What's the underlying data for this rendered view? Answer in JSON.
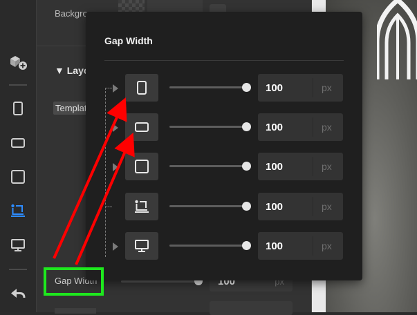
{
  "panel": {
    "background_label": "Backgro",
    "layout_heading": "Layo",
    "template_chip": "Templat",
    "gap_width_row": {
      "label": "Gap Width",
      "value": "100",
      "unit": "px"
    }
  },
  "popup": {
    "title": "Gap Width",
    "devices": [
      {
        "icon": "phone-portrait-icon",
        "value": "100",
        "unit": "px"
      },
      {
        "icon": "phone-landscape-icon",
        "value": "100",
        "unit": "px"
      },
      {
        "icon": "tablet-icon",
        "value": "100",
        "unit": "px"
      },
      {
        "icon": "laptop-icon",
        "value": "100",
        "unit": "px"
      },
      {
        "icon": "desktop-icon",
        "value": "100",
        "unit": "px"
      }
    ]
  },
  "toolbar": {
    "items": [
      "add-block-icon",
      "phone-portrait-icon",
      "phone-landscape-icon",
      "tablet-icon",
      "laptop-icon",
      "desktop-icon",
      "undo-icon"
    ],
    "active": "laptop-icon",
    "active_color": "#2d8cff"
  },
  "colors": {
    "annotation_box": "#1ee81e",
    "annotation_arrow": "#ff0000"
  }
}
